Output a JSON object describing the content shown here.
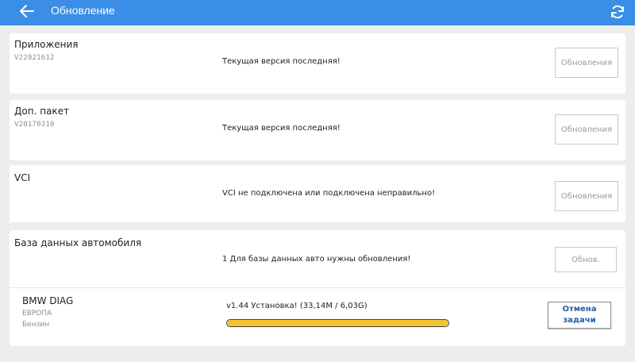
{
  "header": {
    "title": "Обновление",
    "bar_color": "#3a8ee6",
    "back_icon": "arrow-left-icon",
    "refresh_icon": "refresh-icon"
  },
  "cards": [
    {
      "name": "Приложения",
      "version": "V22021612",
      "status": "Текущая версия последняя!",
      "button": "Обновления"
    },
    {
      "name": "Доп. пакет",
      "version": "V20170310",
      "status": "Текущая версия последняя!",
      "button": "Обновления"
    },
    {
      "name": "VCI",
      "status": "VCI не подключена или подключена неправильно!",
      "button": "Обновления"
    }
  ],
  "vehicle_db": {
    "name": "База данных автомобиля",
    "status": "1 Для базы данных авто нужны обновления!",
    "button": "Обнов.",
    "item": {
      "name": "BMW DIAG",
      "region": "ЕВРОПА",
      "fuel": "Бензин",
      "status": "v1.44 Установка! (33,14M / 6,03G)",
      "progress_fraction": 1.0,
      "progress_color": "#f2c330",
      "cancel_button": "Отмена задачи",
      "cancel_color": "#1f5fa8"
    }
  }
}
